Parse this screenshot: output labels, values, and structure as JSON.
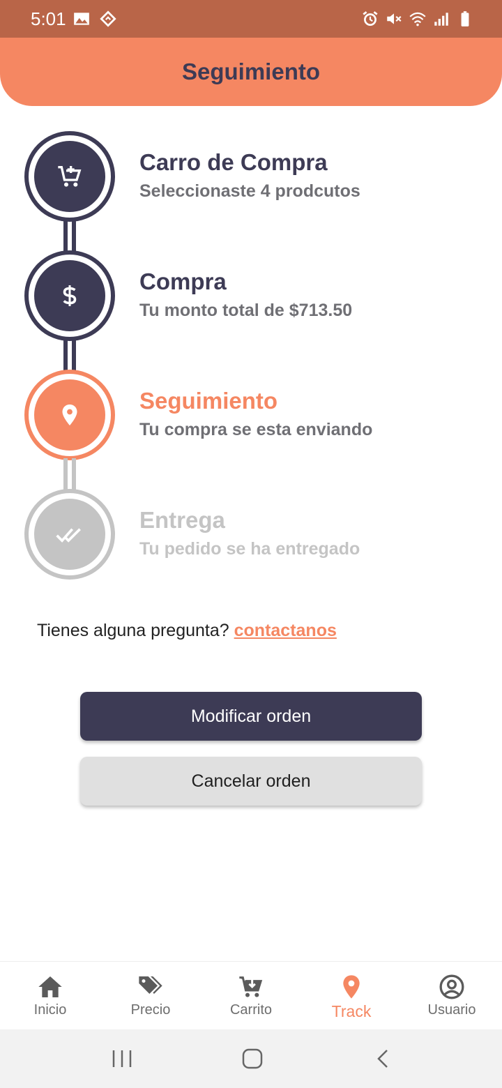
{
  "status_bar": {
    "time": "5:01"
  },
  "header": {
    "title": "Seguimiento"
  },
  "steps": [
    {
      "title": "Carro de Compra",
      "subtitle": "Seleccionaste 4 prodcutos",
      "icon": "add-cart-icon",
      "state": "done"
    },
    {
      "title": "Compra",
      "subtitle": "Tu monto total de $713.50",
      "icon": "dollar-icon",
      "state": "done"
    },
    {
      "title": "Seguimiento",
      "subtitle": "Tu compra se esta enviando",
      "icon": "location-pin-icon",
      "state": "active"
    },
    {
      "title": "Entrega",
      "subtitle": "Tu pedido se ha entregado",
      "icon": "double-check-icon",
      "state": "pending"
    }
  ],
  "question": {
    "text": "Tienes alguna pregunta?",
    "link": "contactanos"
  },
  "buttons": {
    "modify": "Modificar orden",
    "cancel": "Cancelar orden"
  },
  "nav": {
    "items": [
      {
        "label": "Inicio",
        "icon": "home-icon"
      },
      {
        "label": "Precio",
        "icon": "tags-icon"
      },
      {
        "label": "Carrito",
        "icon": "cart-icon"
      },
      {
        "label": "Track",
        "icon": "location-pin-icon"
      },
      {
        "label": "Usuario",
        "icon": "user-icon"
      }
    ],
    "active_index": 3
  },
  "colors": {
    "primary": "#3d3b55",
    "accent": "#f58762",
    "pending": "#c4c4c4",
    "status_bar": "#b96548"
  }
}
